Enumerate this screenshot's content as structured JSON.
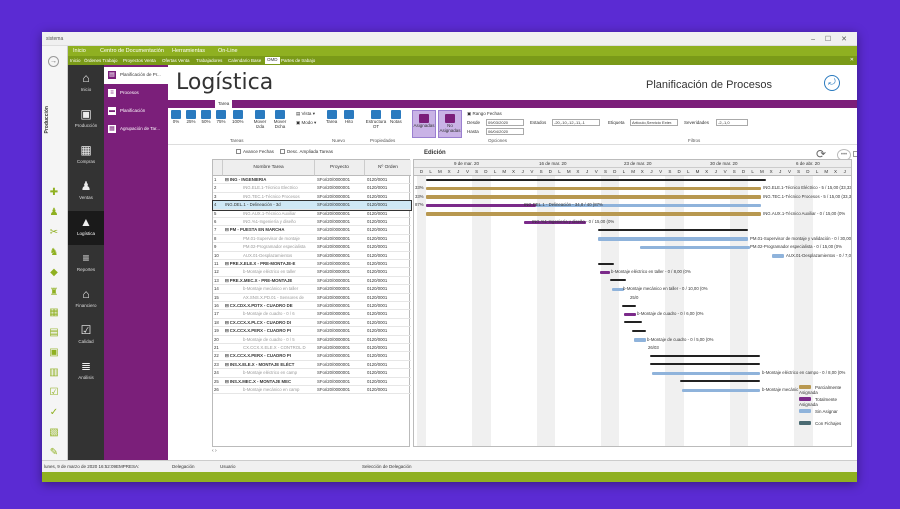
{
  "app": {
    "left_label": "sistema",
    "producción": "Producción"
  },
  "menu": [
    "Inicio",
    "Centro de Documentación",
    "Herramientas",
    "On-Line"
  ],
  "tabs": [
    "Inicio",
    "Órdenes Trabajo",
    "Proyectos Venta",
    "Ofertas Venta",
    "Trabajadores",
    "Calendario Base",
    "OMD",
    "Partes de trabajo"
  ],
  "sidebar": [
    {
      "label": "Inicio",
      "icon": "home-icon",
      "glyph": "⌂"
    },
    {
      "label": "Producción",
      "icon": "factory-icon",
      "glyph": "▣"
    },
    {
      "label": "Compras",
      "icon": "cart-icon",
      "glyph": "▦"
    },
    {
      "label": "Ventas",
      "icon": "people-icon",
      "glyph": "♟"
    },
    {
      "label": "Logística",
      "icon": "chart-icon",
      "glyph": "▲"
    },
    {
      "label": "Reportes",
      "icon": "report-icon",
      "glyph": "≡"
    },
    {
      "label": "Financiero",
      "icon": "bank-icon",
      "glyph": "⌂"
    },
    {
      "label": "Calidad",
      "icon": "check-icon",
      "glyph": "☑"
    },
    {
      "label": "Análisis",
      "icon": "analysis-icon",
      "glyph": "≣"
    }
  ],
  "subnav": [
    "Planificación de Pr...",
    "Procesos",
    "Planificación",
    "Agrupación de Tar..."
  ],
  "page": {
    "title": "Logística",
    "subtitle": "Planificación de Procesos"
  },
  "ribbon": {
    "tab": "Tarea",
    "pct": [
      "0%",
      "25%",
      "50%",
      "75%",
      "100%"
    ],
    "mover_izda": "Mover Izda",
    "mover_dcha": "Mover Dcha",
    "vista": "Vista",
    "modo": "Modo",
    "tarea": "Tarea",
    "hito": "Hito",
    "estructura": "Estructura OT",
    "notas": "Notas",
    "asignadas": "Asignadas",
    "no_asignadas": "No Asignadas",
    "rango": "Rango Fechas",
    "desde_lbl": "Desde",
    "desde": "09/03/2020",
    "hasta_lbl": "Hasta",
    "hasta": "06/04/2020",
    "estados_lbl": "Estados",
    "estados": "-20,-10,-12,-11,-1",
    "etiqueta_lbl": "Etiqueta",
    "etiqueta": "Artículo,Servicio Exter.",
    "severidades_lbl": "Severidades",
    "severidades": "-2,-1,0",
    "groups": {
      "tareas": "Tareas",
      "nuevo": "Nuevo",
      "propiedades": "Propiedades",
      "opciones": "Opciones",
      "filtros": "Filtros"
    }
  },
  "options": {
    "avance": "Avance Fechas",
    "desc": "Desc. Ampliada Tareas"
  },
  "edicion": "Edición",
  "grid": {
    "headers": [
      "Nombre Tarea",
      "Proyecto",
      "Nº Orden"
    ],
    "rows": [
      [
        "1",
        "⊟ ING - INGENIERIA",
        "SFori20/0000001",
        "0120/0001",
        1
      ],
      [
        "2",
        "ING.ELE.1-Técnico Electrico",
        "SFori20/0000001",
        "0120/0001",
        2
      ],
      [
        "3",
        "ING.TEC.1-Técnico Procesos",
        "SFori20/0000001",
        "0120/0001",
        2
      ],
      [
        "4",
        "ING.DEL.1 - Delineación - 3d",
        "SFori20/0000001",
        "0120/0001",
        3
      ],
      [
        "5",
        "ING.AUX.1-Técnico Auxiliar",
        "SFori20/0000001",
        "0120/0001",
        2
      ],
      [
        "6",
        "ING.%1-Ingeniería y diseño",
        "SFori20/0000001",
        "0120/0001",
        2
      ],
      [
        "7",
        "⊟ PM - PUESTA EN MARCHA",
        "SFori20/0000001",
        "0120/0001",
        1
      ],
      [
        "8",
        "PM.01-Supervisor de montaje",
        "SFori20/0000001",
        "0120/0001",
        2
      ],
      [
        "9",
        "PM.02-Programador especialista",
        "SFori20/0000001",
        "0120/0001",
        2
      ],
      [
        "10",
        "AUX.01-Desplazamientos",
        "SFori20/0000001",
        "0120/0001",
        2
      ],
      [
        "11",
        "⊟ PRE.X.ELE.X - PRE-MONTAJE-E",
        "SFori20/0000001",
        "0120/0001",
        1
      ],
      [
        "12",
        "b-Montaje eléctrico en taller",
        "SFori20/0000001",
        "0120/0001",
        2
      ],
      [
        "13",
        "⊟ PRE.X.MEC.X - PRE-MONTAJE",
        "SFori20/0000001",
        "0120/0001",
        1
      ],
      [
        "14",
        "b-Montaje mecánico en taller",
        "SFori20/0000001",
        "0120/0001",
        2
      ],
      [
        "15",
        "AX.SNS.X.PD.01 - Sensores de",
        "SFori20/0000001",
        "0120/0001",
        2
      ],
      [
        "16",
        "⊟ CX.CDX.X.PDTX - CUADRO DE",
        "SFori20/0000001",
        "0120/0001",
        1
      ],
      [
        "17",
        "b-Montaje de cuadro - 0 / 6",
        "SFori20/0000001",
        "0120/0001",
        2
      ],
      [
        "18",
        "⊟ CX.CCX.X.PLCX - CUADRO DI",
        "SFori20/0000001",
        "0120/0001",
        1
      ],
      [
        "19",
        "⊟ CX.CCX.X.PERX - CUADRO PI",
        "SFori20/0000001",
        "0120/0001",
        1
      ],
      [
        "20",
        "b-Montaje de cuadro - 0 / 5",
        "SFori20/0000001",
        "0120/0001",
        2
      ],
      [
        "21",
        "CX.CCX.X.ELE.X - CONTROL D",
        "SFori20/0000001",
        "0120/0001",
        2
      ],
      [
        "22",
        "⊟ CX.CCX.X.PERX - CUADRO PI",
        "SFori20/0000001",
        "0120/0001",
        1
      ],
      [
        "23",
        "⊟ INS.X.ELE.X - MONTAJE ELÉCT",
        "SFori20/0000001",
        "0120/0001",
        1
      ],
      [
        "24",
        "b-Montaje eléctrico en camp",
        "SFori20/0000001",
        "0120/0001",
        2
      ],
      [
        "25",
        "⊟ INS.X.MEC.X - MONTAJE MEC",
        "SFori20/0000001",
        "0120/0001",
        1
      ],
      [
        "26",
        "b-Montaje mecánico en camp",
        "SFori20/0000001",
        "0120/0001",
        2
      ]
    ]
  },
  "gantt": {
    "weeks": [
      "9 de mar. 20",
      "16 de mar. 20",
      "23 de mar. 20",
      "30 de mar. 20",
      "6 de abr. 20",
      "13 de a"
    ],
    "days": [
      "D",
      "L",
      "M",
      "X",
      "J",
      "V",
      "S"
    ],
    "labels": [
      {
        "row": 2,
        "text": "ING.ELE.1-Técnico Eléctrico - 5 / 15,00 (33,33%"
      },
      {
        "row": 3,
        "text": "ING.TEC.1-Técnico Procesos - 5 / 15,00 (33,33%"
      },
      {
        "row": 4,
        "text": "ING.DEL.1 - Delineación - 34,8 / 40 (87%"
      },
      {
        "row": 5,
        "text": "ING.AUX.1-Técnico Auxiliar - 0 / 15,00 (0%"
      },
      {
        "row": 6,
        "text": "ING.%1-Ingeniería y diseño - 0 / 15,00 (0%"
      },
      {
        "row": 8,
        "text": "PM.01-Supervisor de montaje y validación - 0 / 30,00 (0%"
      },
      {
        "row": 9,
        "text": "PM.02-Programador especialista - 0 / 15,00 (0%"
      },
      {
        "row": 10,
        "text": "AUX.01-Desplazamientos - 0 / 7,00 (0%"
      },
      {
        "row": 12,
        "text": "b-Montaje eléctrico en taller - 0 / 8,00 (0%"
      },
      {
        "row": 14,
        "text": "b-Montaje mecánico en taller - 0 / 10,00 (0%"
      },
      {
        "row": 15,
        "text": "25/0"
      },
      {
        "row": 17,
        "text": "b-Montaje de cuadro - 0 / 6,00 (0%"
      },
      {
        "row": 20,
        "text": "b-Montaje de cuadro - 0 / 5,00 (0%"
      },
      {
        "row": 21,
        "text": "26/03"
      },
      {
        "row": 24,
        "text": "b-Montaje eléctrico en campo - 0 / 8,00 (0%"
      },
      {
        "row": 26,
        "text": "b-Montaje mecánic"
      }
    ],
    "pcts": [
      {
        "row": 2,
        "text": "33%"
      },
      {
        "row": 3,
        "text": "33%"
      },
      {
        "row": 4,
        "text": "87%"
      }
    ],
    "legend": [
      {
        "label": "Parcialmente Asignada",
        "color": "#b89850"
      },
      {
        "label": "Totalmente Asignada",
        "color": "#7b2a8a"
      },
      {
        "label": "Sin Asignar",
        "color": "#8fb3db"
      },
      {
        "label": "Con Fichajes",
        "color": "#4a6a72"
      }
    ]
  },
  "status": {
    "date": "lunes, 9 de marzo de 2020 16:52:09",
    "empresa": "EMPRESA:",
    "delegacion": "Delegación",
    "usuario": "Usuario",
    "seleccion": "Selección de Delegación"
  }
}
